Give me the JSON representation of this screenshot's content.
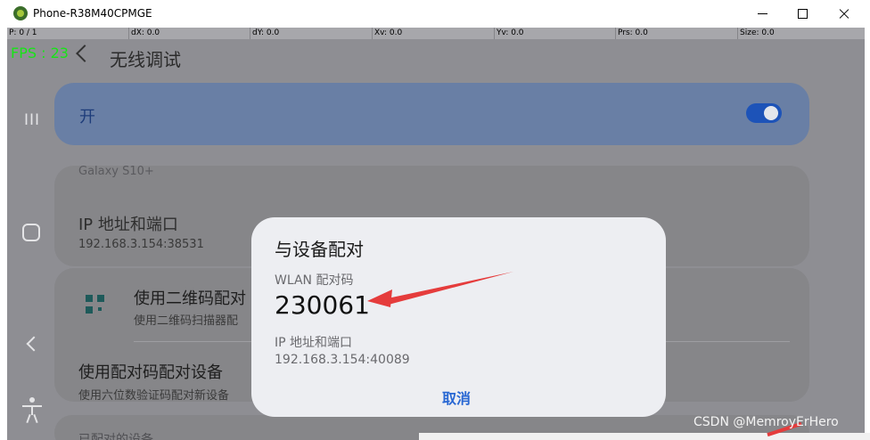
{
  "window": {
    "title": "Phone-R38M40CPMGE"
  },
  "infobar": {
    "p": "P: 0 / 1",
    "dx": "dX: 0.0",
    "dy": "dY: 0.0",
    "xv": "Xv: 0.0",
    "yv": "Yv: 0.0",
    "prs": "Prs: 0.0",
    "size": "Size: 0.0"
  },
  "fps": "FPS : 23",
  "screen": {
    "title": "无线调试"
  },
  "toggle": {
    "label": "开",
    "state": "on"
  },
  "device": {
    "name": "Galaxy S10+",
    "ip_title": "IP 地址和端口",
    "ip_value": "192.168.3.154:38531"
  },
  "qr_pair": {
    "title": "使用二维码配对",
    "subtitle": "使用二维码扫描器配"
  },
  "code_pair": {
    "title": "使用配对码配对设备",
    "subtitle": "使用六位数验证码配对新设备"
  },
  "paired_header": "已配对的设备",
  "dialog": {
    "title": "与设备配对",
    "code_label": "WLAN 配对码",
    "code": "230061",
    "ip_label": "IP 地址和端口",
    "ip_value": "192.168.3.154:40089",
    "cancel": "取消"
  },
  "watermark": "CSDN @MemroyErHero",
  "colors": {
    "accent": "#2867d3",
    "arrow": "#e53c3c",
    "fps": "#17e417"
  },
  "icons": [
    "android-icon",
    "back-arrow-icon",
    "recents-icon",
    "home-icon",
    "nav-back-icon",
    "accessibility-icon",
    "qr-code-icon"
  ]
}
